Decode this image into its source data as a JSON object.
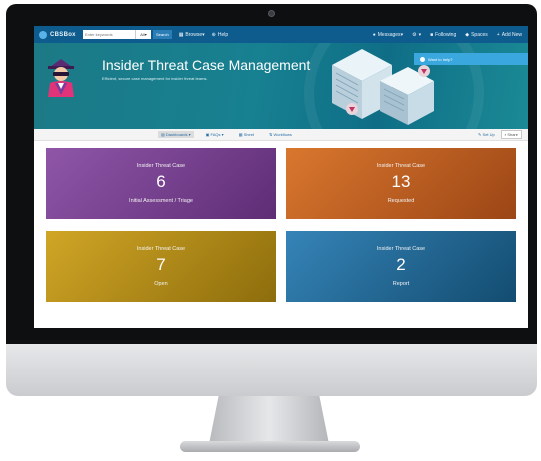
{
  "navbar": {
    "brand": "CBSBox",
    "search_placeholder": "Enter keywords",
    "search_scope": "All",
    "search_button": "Search",
    "menu": [
      {
        "label": "Browse",
        "icon": "grid-icon"
      },
      {
        "label": "Help",
        "icon": "help-icon"
      }
    ],
    "right_menu": [
      {
        "label": "Messages",
        "icon": "user-icon"
      },
      {
        "label": "",
        "icon": "gear-icon"
      },
      {
        "label": "Following",
        "icon": "bookmark-icon"
      },
      {
        "label": "Spaces",
        "icon": "spaces-icon"
      },
      {
        "label": "Add New",
        "icon": "plus-icon"
      }
    ]
  },
  "banner": {
    "title": "Insider Threat Case Management",
    "subtitle": "Efficient, secure case management for insider threat teams.",
    "help_text": "Want to help?"
  },
  "subnav": {
    "tabs": [
      {
        "label": "Dashboards",
        "icon": "dashboard-icon",
        "active": true
      },
      {
        "label": "FAQs",
        "icon": "faq-icon",
        "active": false
      },
      {
        "label": "Sheet",
        "icon": "sheet-icon",
        "active": false
      },
      {
        "label": "Workflows",
        "icon": "workflow-icon",
        "active": false
      }
    ],
    "setup_label": "Set Up",
    "share_label": "Share"
  },
  "cards": [
    {
      "title": "Insider Threat Case",
      "count": "6",
      "label": "Initial Assessment / Triage",
      "color": "#7a4592"
    },
    {
      "title": "Insider Threat Case",
      "count": "13",
      "label": "Requested",
      "color": "#c0632a"
    },
    {
      "title": "Insider Threat Case",
      "count": "7",
      "label": "Open",
      "color": "#b9921e"
    },
    {
      "title": "Insider Threat Case",
      "count": "2",
      "label": "Report",
      "color": "#246a97"
    }
  ]
}
